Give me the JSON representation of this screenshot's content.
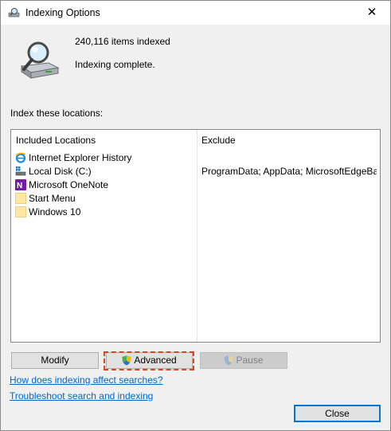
{
  "window": {
    "title": "Indexing Options",
    "close_glyph": "✕"
  },
  "summary": {
    "count_text": "240,116 items indexed",
    "status_text": "Indexing complete."
  },
  "locations": {
    "label": "Index these locations:",
    "header_included": "Included Locations",
    "header_exclude": "Exclude",
    "rows": [
      {
        "name": "Internet Explorer History",
        "icon": "ie-icon",
        "exclude": ""
      },
      {
        "name": "Local Disk (C:)",
        "icon": "drive-icon",
        "exclude": "ProgramData; AppData; MicrosoftEdgeBac..."
      },
      {
        "name": "Microsoft OneNote",
        "icon": "onenote-icon",
        "exclude": ""
      },
      {
        "name": "Start Menu",
        "icon": "folder-icon",
        "exclude": ""
      },
      {
        "name": "Windows 10",
        "icon": "folder-icon",
        "exclude": ""
      }
    ]
  },
  "buttons": {
    "modify": "Modify",
    "advanced": "Advanced",
    "pause": "Pause",
    "close": "Close"
  },
  "links": {
    "how": "How does indexing affect searches?",
    "troubleshoot": "Troubleshoot search and indexing"
  },
  "colors": {
    "link": "#0066cc",
    "highlight": "#e0441b",
    "accent": "#0078d7"
  }
}
